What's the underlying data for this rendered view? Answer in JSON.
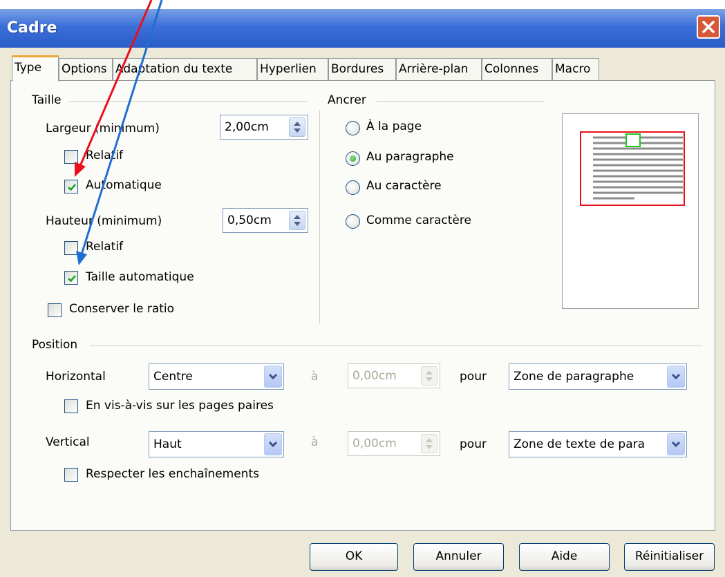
{
  "window": {
    "title": "Cadre",
    "close_icon": "close-icon"
  },
  "tabs": [
    {
      "label": "Type",
      "active": true
    },
    {
      "label": "Options"
    },
    {
      "label": "Adaptation du texte"
    },
    {
      "label": "Hyperlien"
    },
    {
      "label": "Bordures"
    },
    {
      "label": "Arrière-plan"
    },
    {
      "label": "Colonnes"
    },
    {
      "label": "Macro"
    }
  ],
  "taille": {
    "group_label": "Taille",
    "largeur_label": "Largeur (minimum)",
    "largeur_value": "2,00cm",
    "relatif1_label": "Relatif",
    "relatif1_checked": false,
    "automatique_label": "Automatique",
    "automatique_checked": true,
    "hauteur_label": "Hauteur (minimum)",
    "hauteur_value": "0,50cm",
    "relatif2_label": "Relatif",
    "relatif2_checked": false,
    "taille_auto_label": "Taille automatique",
    "taille_auto_checked": true,
    "ratio_label": "Conserver le ratio",
    "ratio_checked": false
  },
  "ancrer": {
    "group_label": "Ancrer",
    "options": [
      "À la page",
      "Au paragraphe",
      "Au caractère",
      "Comme caractère"
    ],
    "selected": "Au paragraphe"
  },
  "position": {
    "group_label": "Position",
    "horizontal_label": "Horizontal",
    "horizontal_value": "Centre",
    "a_label": "à",
    "horizontal_offset": "0,00cm",
    "pour_label": "pour",
    "horizontal_pour": "Zone de paragraphe",
    "vis_a_vis_label": "En vis-à-vis sur les pages paires",
    "vis_a_vis_checked": false,
    "vertical_label": "Vertical",
    "vertical_value": "Haut",
    "vertical_offset": "0,00cm",
    "vertical_pour": "Zone de texte de para",
    "enchainements_label": "Respecter les enchaînements",
    "enchainements_checked": false
  },
  "buttons": {
    "ok": "OK",
    "annuler": "Annuler",
    "aide": "Aide",
    "reinitialiser": "Réinitialiser"
  },
  "colors": {
    "title_bar": "#2a5cc9",
    "dialog_bg": "#ece9d8",
    "annotation_red": "#e8101a",
    "annotation_blue": "#1f6fd0",
    "check_green": "#21a121"
  }
}
